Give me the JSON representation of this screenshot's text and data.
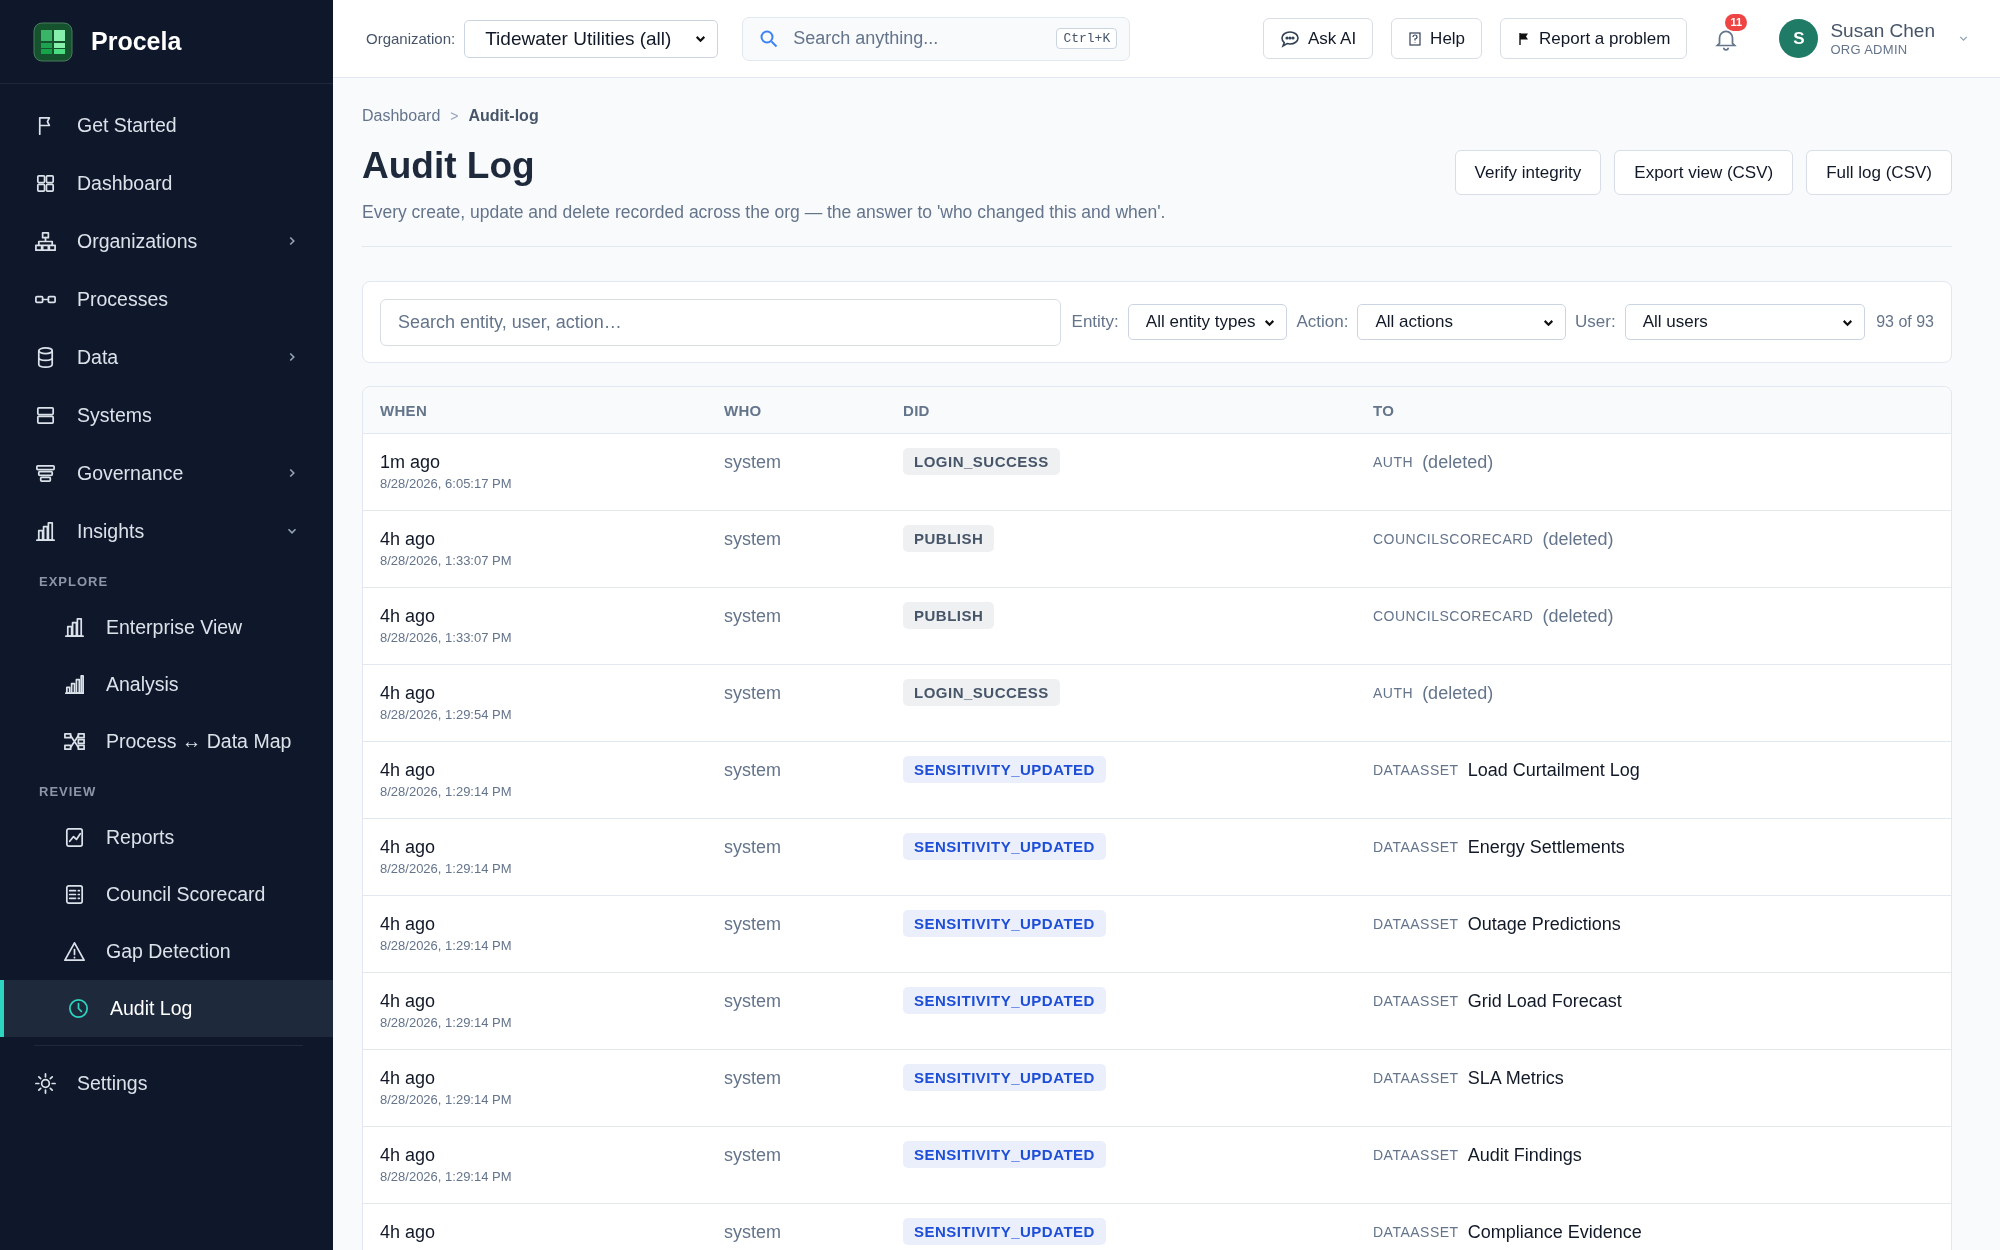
{
  "sidebar": {
    "brand": "Procela",
    "nav": [
      {
        "label": "Get Started",
        "selected": false
      },
      {
        "label": "Dashboard",
        "selected": false
      },
      {
        "label": "Organizations",
        "selected": false,
        "expanded": false
      },
      {
        "label": "Processes",
        "selected": false
      },
      {
        "label": "Data",
        "selected": false,
        "expanded": false
      },
      {
        "label": "Systems",
        "selected": false
      },
      {
        "label": "Governance",
        "selected": false,
        "expanded": false
      },
      {
        "label": "Insights",
        "selected": false,
        "expanded": true,
        "groups": [
          {
            "heading": "EXPLORE",
            "items": [
              {
                "label": "Enterprise View",
                "selected": false
              },
              {
                "label": "Analysis",
                "selected": false
              },
              {
                "label": "Process ↔ Data Map",
                "selected": false
              }
            ]
          },
          {
            "heading": "REVIEW",
            "items": [
              {
                "label": "Reports",
                "selected": false
              },
              {
                "label": "Council Scorecard",
                "selected": false
              },
              {
                "label": "Gap Detection",
                "selected": false
              },
              {
                "label": "Audit Log",
                "selected": true
              }
            ]
          }
        ]
      }
    ],
    "footer": [
      {
        "label": "Settings",
        "selected": false
      }
    ]
  },
  "topbar": {
    "org_label": "Organization:",
    "org_value": "Tidewater Utilities (all)",
    "search_placeholder": "Search anything...",
    "shortcut": "Ctrl+K",
    "buttons": [
      "Ask AI",
      "Help",
      "Report a problem"
    ],
    "notifications": "11",
    "user": {
      "initial": "S",
      "name": "Susan Chen",
      "role": "ORG ADMIN"
    }
  },
  "breadcrumb": {
    "items": [
      "Dashboard",
      "Audit-log"
    ],
    "separator": ">"
  },
  "page": {
    "title": "Audit Log",
    "subtitle": "Every create, update and delete recorded across the org — the answer to 'who changed this and when'.",
    "actions": [
      "Verify integrity",
      "Export view (CSV)",
      "Full log (CSV)"
    ]
  },
  "filters": {
    "search_placeholder": "Search entity, user, action…",
    "selects": [
      {
        "label": "Entity:",
        "value": "All entity types"
      },
      {
        "label": "Action:",
        "value": "All actions"
      },
      {
        "label": "User:",
        "value": "All users"
      }
    ],
    "count": "93 of 93"
  },
  "table": {
    "columns": [
      "WHEN",
      "WHO",
      "DID",
      "TO"
    ],
    "rows": [
      {
        "when": "1m ago",
        "timestamp": "8/28/2026, 6:05:17 PM",
        "who": "system",
        "action": {
          "text": "LOGIN_SUCCESS",
          "color": "#475569"
        },
        "entity_type": "AUTH",
        "target": "(deleted)",
        "deleted": true
      },
      {
        "when": "4h ago",
        "timestamp": "8/28/2026, 1:33:07 PM",
        "who": "system",
        "action": {
          "text": "PUBLISH",
          "color": "#475569"
        },
        "entity_type": "COUNCILSCORECARD",
        "target": "(deleted)",
        "deleted": true
      },
      {
        "when": "4h ago",
        "timestamp": "8/28/2026, 1:33:07 PM",
        "who": "system",
        "action": {
          "text": "PUBLISH",
          "color": "#475569"
        },
        "entity_type": "COUNCILSCORECARD",
        "target": "(deleted)",
        "deleted": true
      },
      {
        "when": "4h ago",
        "timestamp": "8/28/2026, 1:29:54 PM",
        "who": "system",
        "action": {
          "text": "LOGIN_SUCCESS",
          "color": "#475569"
        },
        "entity_type": "AUTH",
        "target": "(deleted)",
        "deleted": true
      },
      {
        "when": "4h ago",
        "timestamp": "8/28/2026, 1:29:14 PM",
        "who": "system",
        "action": {
          "text": "SENSITIVITY_UPDATED",
          "color": "#1d4ed8"
        },
        "entity_type": "DATAASSET",
        "target": "Load Curtailment Log",
        "deleted": false
      },
      {
        "when": "4h ago",
        "timestamp": "8/28/2026, 1:29:14 PM",
        "who": "system",
        "action": {
          "text": "SENSITIVITY_UPDATED",
          "color": "#1d4ed8"
        },
        "entity_type": "DATAASSET",
        "target": "Energy Settlements",
        "deleted": false
      },
      {
        "when": "4h ago",
        "timestamp": "8/28/2026, 1:29:14 PM",
        "who": "system",
        "action": {
          "text": "SENSITIVITY_UPDATED",
          "color": "#1d4ed8"
        },
        "entity_type": "DATAASSET",
        "target": "Outage Predictions",
        "deleted": false
      },
      {
        "when": "4h ago",
        "timestamp": "8/28/2026, 1:29:14 PM",
        "who": "system",
        "action": {
          "text": "SENSITIVITY_UPDATED",
          "color": "#1d4ed8"
        },
        "entity_type": "DATAASSET",
        "target": "Grid Load Forecast",
        "deleted": false
      },
      {
        "when": "4h ago",
        "timestamp": "8/28/2026, 1:29:14 PM",
        "who": "system",
        "action": {
          "text": "SENSITIVITY_UPDATED",
          "color": "#1d4ed8"
        },
        "entity_type": "DATAASSET",
        "target": "SLA Metrics",
        "deleted": false
      },
      {
        "when": "4h ago",
        "timestamp": "8/28/2026, 1:29:14 PM",
        "who": "system",
        "action": {
          "text": "SENSITIVITY_UPDATED",
          "color": "#1d4ed8"
        },
        "entity_type": "DATAASSET",
        "target": "Audit Findings",
        "deleted": false
      },
      {
        "when": "4h ago",
        "who": "system",
        "action": {
          "text": "SENSITIVITY_UPDATED",
          "color": "#1d4ed8"
        },
        "entity_type": "DATAASSET",
        "target": "Compliance Evidence",
        "deleted": false
      }
    ]
  }
}
